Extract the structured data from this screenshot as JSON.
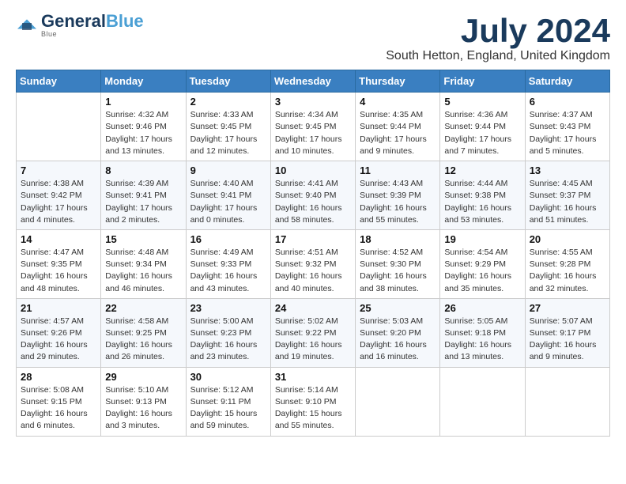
{
  "header": {
    "logo_general": "General",
    "logo_blue": "Blue",
    "month": "July 2024",
    "location": "South Hetton, England, United Kingdom"
  },
  "weekdays": [
    "Sunday",
    "Monday",
    "Tuesday",
    "Wednesday",
    "Thursday",
    "Friday",
    "Saturday"
  ],
  "weeks": [
    [
      {
        "day": "",
        "sunrise": "",
        "sunset": "",
        "daylight": ""
      },
      {
        "day": "1",
        "sunrise": "Sunrise: 4:32 AM",
        "sunset": "Sunset: 9:46 PM",
        "daylight": "Daylight: 17 hours and 13 minutes."
      },
      {
        "day": "2",
        "sunrise": "Sunrise: 4:33 AM",
        "sunset": "Sunset: 9:45 PM",
        "daylight": "Daylight: 17 hours and 12 minutes."
      },
      {
        "day": "3",
        "sunrise": "Sunrise: 4:34 AM",
        "sunset": "Sunset: 9:45 PM",
        "daylight": "Daylight: 17 hours and 10 minutes."
      },
      {
        "day": "4",
        "sunrise": "Sunrise: 4:35 AM",
        "sunset": "Sunset: 9:44 PM",
        "daylight": "Daylight: 17 hours and 9 minutes."
      },
      {
        "day": "5",
        "sunrise": "Sunrise: 4:36 AM",
        "sunset": "Sunset: 9:44 PM",
        "daylight": "Daylight: 17 hours and 7 minutes."
      },
      {
        "day": "6",
        "sunrise": "Sunrise: 4:37 AM",
        "sunset": "Sunset: 9:43 PM",
        "daylight": "Daylight: 17 hours and 5 minutes."
      }
    ],
    [
      {
        "day": "7",
        "sunrise": "Sunrise: 4:38 AM",
        "sunset": "Sunset: 9:42 PM",
        "daylight": "Daylight: 17 hours and 4 minutes."
      },
      {
        "day": "8",
        "sunrise": "Sunrise: 4:39 AM",
        "sunset": "Sunset: 9:41 PM",
        "daylight": "Daylight: 17 hours and 2 minutes."
      },
      {
        "day": "9",
        "sunrise": "Sunrise: 4:40 AM",
        "sunset": "Sunset: 9:41 PM",
        "daylight": "Daylight: 17 hours and 0 minutes."
      },
      {
        "day": "10",
        "sunrise": "Sunrise: 4:41 AM",
        "sunset": "Sunset: 9:40 PM",
        "daylight": "Daylight: 16 hours and 58 minutes."
      },
      {
        "day": "11",
        "sunrise": "Sunrise: 4:43 AM",
        "sunset": "Sunset: 9:39 PM",
        "daylight": "Daylight: 16 hours and 55 minutes."
      },
      {
        "day": "12",
        "sunrise": "Sunrise: 4:44 AM",
        "sunset": "Sunset: 9:38 PM",
        "daylight": "Daylight: 16 hours and 53 minutes."
      },
      {
        "day": "13",
        "sunrise": "Sunrise: 4:45 AM",
        "sunset": "Sunset: 9:37 PM",
        "daylight": "Daylight: 16 hours and 51 minutes."
      }
    ],
    [
      {
        "day": "14",
        "sunrise": "Sunrise: 4:47 AM",
        "sunset": "Sunset: 9:35 PM",
        "daylight": "Daylight: 16 hours and 48 minutes."
      },
      {
        "day": "15",
        "sunrise": "Sunrise: 4:48 AM",
        "sunset": "Sunset: 9:34 PM",
        "daylight": "Daylight: 16 hours and 46 minutes."
      },
      {
        "day": "16",
        "sunrise": "Sunrise: 4:49 AM",
        "sunset": "Sunset: 9:33 PM",
        "daylight": "Daylight: 16 hours and 43 minutes."
      },
      {
        "day": "17",
        "sunrise": "Sunrise: 4:51 AM",
        "sunset": "Sunset: 9:32 PM",
        "daylight": "Daylight: 16 hours and 40 minutes."
      },
      {
        "day": "18",
        "sunrise": "Sunrise: 4:52 AM",
        "sunset": "Sunset: 9:30 PM",
        "daylight": "Daylight: 16 hours and 38 minutes."
      },
      {
        "day": "19",
        "sunrise": "Sunrise: 4:54 AM",
        "sunset": "Sunset: 9:29 PM",
        "daylight": "Daylight: 16 hours and 35 minutes."
      },
      {
        "day": "20",
        "sunrise": "Sunrise: 4:55 AM",
        "sunset": "Sunset: 9:28 PM",
        "daylight": "Daylight: 16 hours and 32 minutes."
      }
    ],
    [
      {
        "day": "21",
        "sunrise": "Sunrise: 4:57 AM",
        "sunset": "Sunset: 9:26 PM",
        "daylight": "Daylight: 16 hours and 29 minutes."
      },
      {
        "day": "22",
        "sunrise": "Sunrise: 4:58 AM",
        "sunset": "Sunset: 9:25 PM",
        "daylight": "Daylight: 16 hours and 26 minutes."
      },
      {
        "day": "23",
        "sunrise": "Sunrise: 5:00 AM",
        "sunset": "Sunset: 9:23 PM",
        "daylight": "Daylight: 16 hours and 23 minutes."
      },
      {
        "day": "24",
        "sunrise": "Sunrise: 5:02 AM",
        "sunset": "Sunset: 9:22 PM",
        "daylight": "Daylight: 16 hours and 19 minutes."
      },
      {
        "day": "25",
        "sunrise": "Sunrise: 5:03 AM",
        "sunset": "Sunset: 9:20 PM",
        "daylight": "Daylight: 16 hours and 16 minutes."
      },
      {
        "day": "26",
        "sunrise": "Sunrise: 5:05 AM",
        "sunset": "Sunset: 9:18 PM",
        "daylight": "Daylight: 16 hours and 13 minutes."
      },
      {
        "day": "27",
        "sunrise": "Sunrise: 5:07 AM",
        "sunset": "Sunset: 9:17 PM",
        "daylight": "Daylight: 16 hours and 9 minutes."
      }
    ],
    [
      {
        "day": "28",
        "sunrise": "Sunrise: 5:08 AM",
        "sunset": "Sunset: 9:15 PM",
        "daylight": "Daylight: 16 hours and 6 minutes."
      },
      {
        "day": "29",
        "sunrise": "Sunrise: 5:10 AM",
        "sunset": "Sunset: 9:13 PM",
        "daylight": "Daylight: 16 hours and 3 minutes."
      },
      {
        "day": "30",
        "sunrise": "Sunrise: 5:12 AM",
        "sunset": "Sunset: 9:11 PM",
        "daylight": "Daylight: 15 hours and 59 minutes."
      },
      {
        "day": "31",
        "sunrise": "Sunrise: 5:14 AM",
        "sunset": "Sunset: 9:10 PM",
        "daylight": "Daylight: 15 hours and 55 minutes."
      },
      {
        "day": "",
        "sunrise": "",
        "sunset": "",
        "daylight": ""
      },
      {
        "day": "",
        "sunrise": "",
        "sunset": "",
        "daylight": ""
      },
      {
        "day": "",
        "sunrise": "",
        "sunset": "",
        "daylight": ""
      }
    ]
  ]
}
